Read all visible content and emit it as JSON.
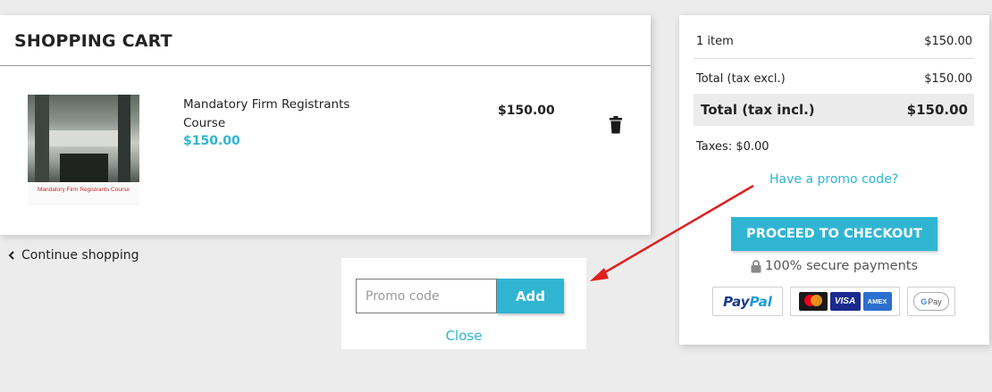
{
  "cart": {
    "title": "SHOPPING CART",
    "item": {
      "name": "Mandatory Firm Registrants Course",
      "unit_price": "$150.00",
      "line_total": "$150.00",
      "image_caption": "Mandatory Firm Registrants Course"
    },
    "continue_label": "Continue shopping"
  },
  "promo": {
    "placeholder": "Promo code",
    "add_label": "Add",
    "close_label": "Close"
  },
  "summary": {
    "items_label": "1 item",
    "items_value": "$150.00",
    "excl_label": "Total (tax excl.)",
    "excl_value": "$150.00",
    "incl_label": "Total (tax incl.)",
    "incl_value": "$150.00",
    "taxes": "Taxes: $0.00",
    "promo_link": "Have a promo code?",
    "checkout_label": "PROCEED TO CHECKOUT",
    "secure_label": "100% secure payments",
    "payments": {
      "paypal_part1": "Pay",
      "paypal_part2": "Pal",
      "visa": "VISA",
      "amex": "AMEX",
      "gpay_g": "G",
      "gpay_pay": "Pay"
    }
  },
  "colors": {
    "accent": "#2fb5d2",
    "annotation_arrow": "#e02020"
  }
}
